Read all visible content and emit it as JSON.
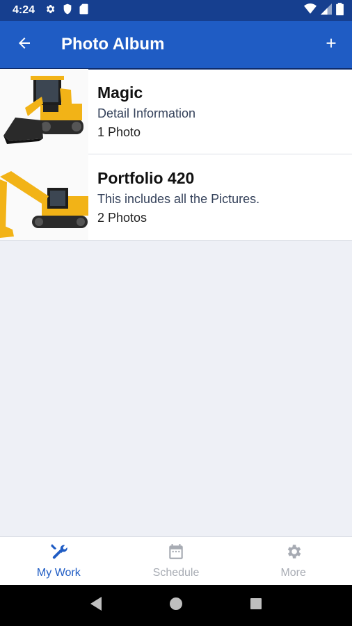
{
  "status_bar": {
    "time": "4:24",
    "left_icons": [
      "gear-icon",
      "shield-icon",
      "sd-card-icon"
    ],
    "right_icons": [
      "wifi-icon",
      "signal-icon",
      "battery-icon"
    ]
  },
  "app_bar": {
    "title": "Photo Album",
    "back_icon": "arrow-left-icon",
    "add_icon": "plus-icon",
    "color": "#1f5cc4"
  },
  "albums": [
    {
      "name": "Magic",
      "description": "Detail Information",
      "count": "1 Photo",
      "thumbnail": "skid-steer-loader"
    },
    {
      "name": "Portfolio 420",
      "description": "This includes all the Pictures.",
      "count": "2 Photos",
      "thumbnail": "excavator"
    }
  ],
  "bottom_nav": {
    "items": [
      {
        "label": "My Work",
        "icon": "tools-icon",
        "active": true
      },
      {
        "label": "Schedule",
        "icon": "calendar-icon",
        "active": false
      },
      {
        "label": "More",
        "icon": "gear-icon",
        "active": false
      }
    ],
    "active_color": "#1f5cc4",
    "inactive_color": "#a7abb3"
  },
  "system_nav": [
    "back-triangle-icon",
    "home-circle-icon",
    "recents-square-icon"
  ]
}
